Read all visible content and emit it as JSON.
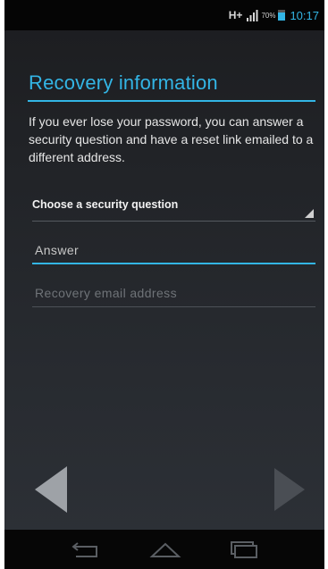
{
  "status_bar": {
    "network": "H+",
    "battery_percent": "70%",
    "time": "10:17"
  },
  "screen": {
    "title": "Recovery information",
    "description": "If you ever lose your password, you can answer a security question and have a reset link emailed to a different address."
  },
  "form": {
    "security_question": {
      "value": "Choose a security question"
    },
    "answer": {
      "placeholder": "Answer"
    },
    "recovery_email": {
      "placeholder": "Recovery email address"
    }
  },
  "navigation": {
    "back_icon": "left-triangle-icon",
    "next_icon": "right-triangle-icon"
  },
  "system_nav": {
    "back_icon": "back-icon",
    "home_icon": "home-icon",
    "recents_icon": "recent-apps-icon"
  },
  "colors": {
    "accent": "#33b5e5",
    "background": "#222529"
  }
}
